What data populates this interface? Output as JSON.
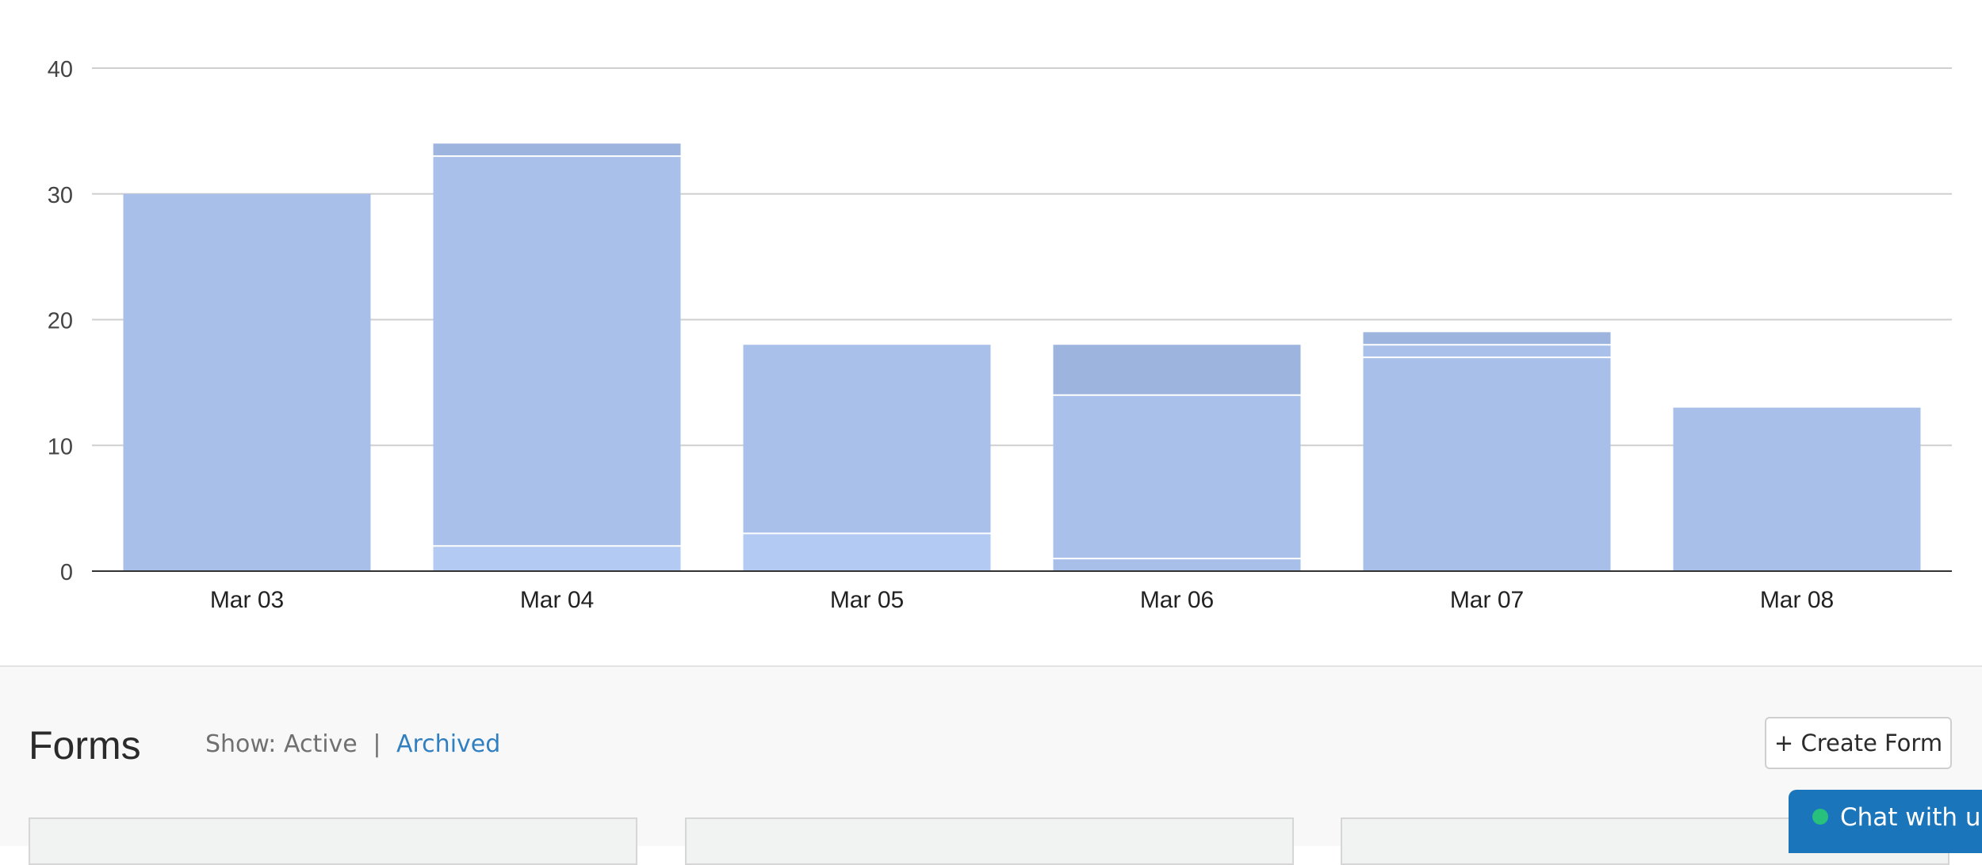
{
  "chart_data": {
    "type": "bar",
    "stacked": true,
    "categories": [
      "Mar 03",
      "Mar 04",
      "Mar 05",
      "Mar 06",
      "Mar 07",
      "Mar 08"
    ],
    "ylim": [
      0,
      40
    ],
    "yticks": [
      0,
      10,
      20,
      30,
      40
    ],
    "grid": true,
    "stacks": [
      [
        30
      ],
      [
        2,
        31,
        1
      ],
      [
        3,
        15
      ],
      [
        1,
        13,
        4
      ],
      [
        17,
        1,
        1
      ],
      [
        13
      ]
    ],
    "segment_colors": [
      "#aac2ea",
      "#a8c0e9",
      "#a9c1ea",
      "#9db4de",
      "#a0b7e0"
    ],
    "bottom_segment_colors": [
      "#a8c0e9",
      "#b3cbf3",
      "#b3cbf3",
      "#a8c0e9",
      "#a8c0e9",
      "#a8c0e9"
    ]
  },
  "forms": {
    "title": "Forms",
    "show_prefix": "Show:",
    "active_label": "Active",
    "separator": "|",
    "archived_label": "Archived",
    "create_button": "+ Create Form"
  },
  "chat": {
    "label": "Chat with us"
  },
  "colors": {
    "accent_link": "#2f7fc1",
    "chat_bg": "#1b75bb",
    "chat_status": "#27c07d",
    "bar_fill": "#a8c0e9"
  }
}
